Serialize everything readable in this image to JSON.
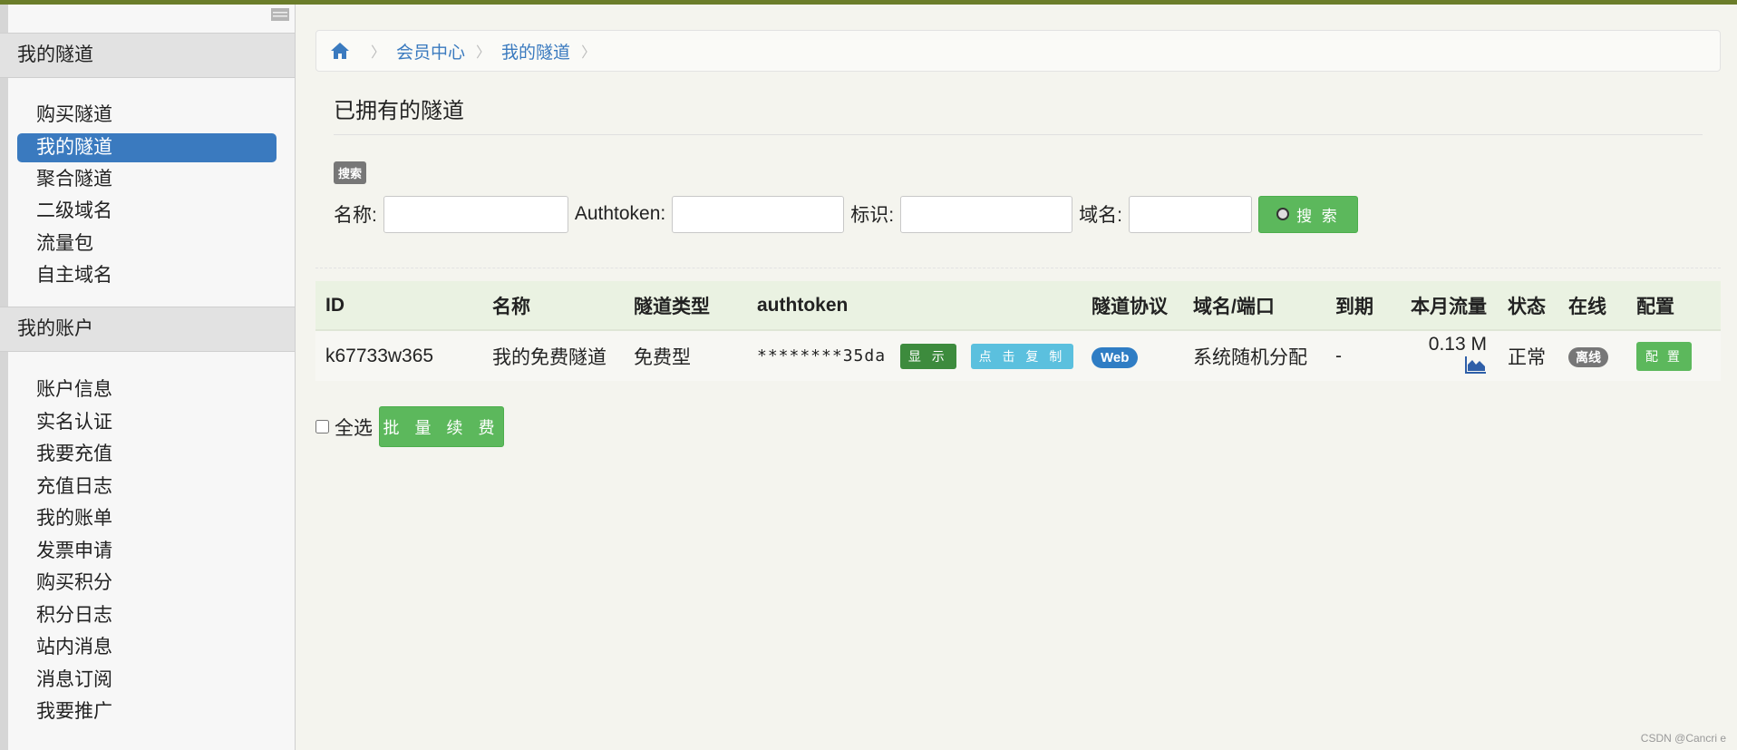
{
  "sidebar": {
    "collapse_icon": "menu-icon",
    "sections": [
      {
        "title": "我的隧道",
        "items": [
          {
            "label": "购买隧道",
            "active": false
          },
          {
            "label": "我的隧道",
            "active": true
          },
          {
            "label": "聚合隧道",
            "active": false
          },
          {
            "label": "二级域名",
            "active": false
          },
          {
            "label": "流量包",
            "active": false
          },
          {
            "label": "自主域名",
            "active": false
          }
        ]
      },
      {
        "title": "我的账户",
        "items": [
          {
            "label": "账户信息"
          },
          {
            "label": "实名认证"
          },
          {
            "label": "我要充值"
          },
          {
            "label": "充值日志"
          },
          {
            "label": "我的账单"
          },
          {
            "label": "发票申请"
          },
          {
            "label": "购买积分"
          },
          {
            "label": "积分日志"
          },
          {
            "label": "站内消息"
          },
          {
            "label": "消息订阅"
          },
          {
            "label": "我要推广"
          }
        ]
      }
    ]
  },
  "breadcrumb": {
    "home_icon": "home-icon",
    "items": [
      "会员中心",
      "我的隧道"
    ]
  },
  "page": {
    "title": "已拥有的隧道"
  },
  "search": {
    "badge": "搜索",
    "name_label": "名称:",
    "name_value": "",
    "authtoken_label": "Authtoken:",
    "authtoken_value": "",
    "tag_label": "标识:",
    "tag_value": "",
    "domain_label": "域名:",
    "domain_value": "",
    "button_label": "搜 索"
  },
  "table": {
    "headers": [
      "ID",
      "名称",
      "隧道类型",
      "authtoken",
      "隧道协议",
      "域名/端口",
      "到期",
      "本月流量",
      "状态",
      "在线",
      "配置"
    ],
    "rows": [
      {
        "id": "k67733w365",
        "name": "我的免费隧道",
        "type": "免费型",
        "authtoken": "********35da",
        "show_label": "显 示",
        "copy_label": "点 击 复 制",
        "protocol": "Web",
        "domain": "系统随机分配",
        "expire": "-",
        "traffic": "0.13 M",
        "status": "正常",
        "online": "离线",
        "config_label": "配 置"
      }
    ]
  },
  "footer": {
    "select_all_label": "全选",
    "batch_renew_label": "批 量 续 费"
  },
  "watermark": "CSDN @Cancri e",
  "colors": {
    "accent_blue": "#3a7abf",
    "green_button": "#5cb85c",
    "top_bar": "#6b7d2a"
  }
}
